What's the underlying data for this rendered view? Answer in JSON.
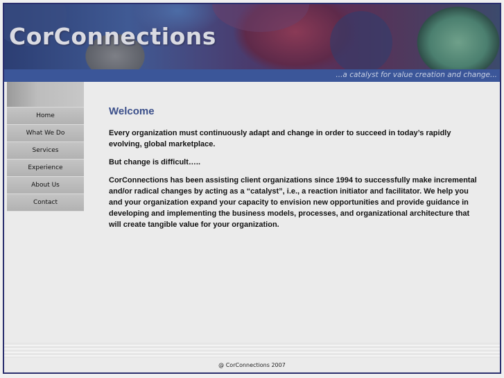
{
  "header": {
    "site_title": "CorConnections",
    "tagline": "...a catalyst for value creation and change..."
  },
  "sidebar": {
    "items": [
      {
        "label": "Home"
      },
      {
        "label": "What We Do"
      },
      {
        "label": "Services"
      },
      {
        "label": "Experience"
      },
      {
        "label": "About Us"
      },
      {
        "label": "Contact"
      }
    ]
  },
  "main": {
    "title": "Welcome",
    "paragraphs": [
      "Every organization must continuously adapt and change in order to succeed in today’s rapidly evolving, global marketplace.",
      "But change is difficult…..",
      "CorConnections has been assisting client organizations since 1994 to successfully make incremental and/or radical changes by acting as a “catalyst”, i.e., a reaction initiator and facilitator. We help you and your organization expand your capacity to envision new opportunities and provide guidance in developing and implementing the business models, processes, and organizational architecture that will create tangible value for your organization."
    ]
  },
  "footer": {
    "copyright": "@ CorConnections 2007"
  },
  "colors": {
    "frame_border": "#2a2f6e",
    "tagbar": "#3b5699",
    "title_accent": "#3b4f8a"
  }
}
